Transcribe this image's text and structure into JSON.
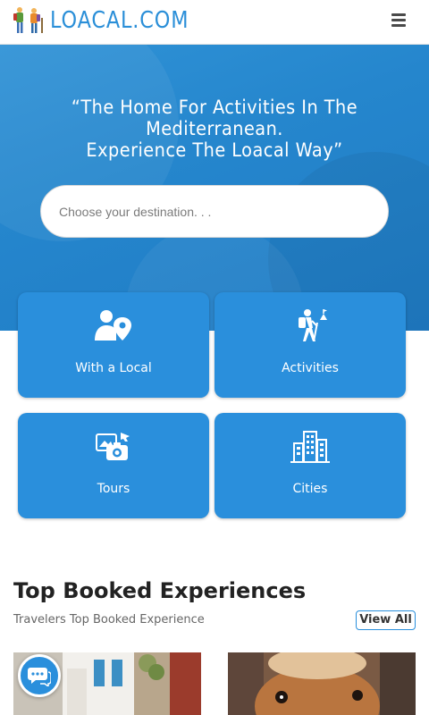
{
  "header": {
    "logo_text": "LOACAL.COM",
    "menu_icon": "hamburger-icon"
  },
  "hero": {
    "quote_line1": "“The Home For Activities In The",
    "quote_line2": "Mediterranean.",
    "quote_line3": "Experience The Loacal Way”",
    "search_placeholder": "Choose your destination. . ."
  },
  "categories": [
    {
      "label": "With a Local",
      "icon": "person-location-icon"
    },
    {
      "label": "Activities",
      "icon": "hiker-icon"
    },
    {
      "label": "Tours",
      "icon": "tour-camera-icon"
    },
    {
      "label": "Cities",
      "icon": "city-buildings-icon"
    }
  ],
  "top_booked": {
    "title": "Top Booked Experiences",
    "subtitle": "Travelers Top Booked Experience",
    "view_all": "View All"
  },
  "colors": {
    "brand_blue": "#2a8fdc",
    "hero_blue": "#2586cd"
  }
}
